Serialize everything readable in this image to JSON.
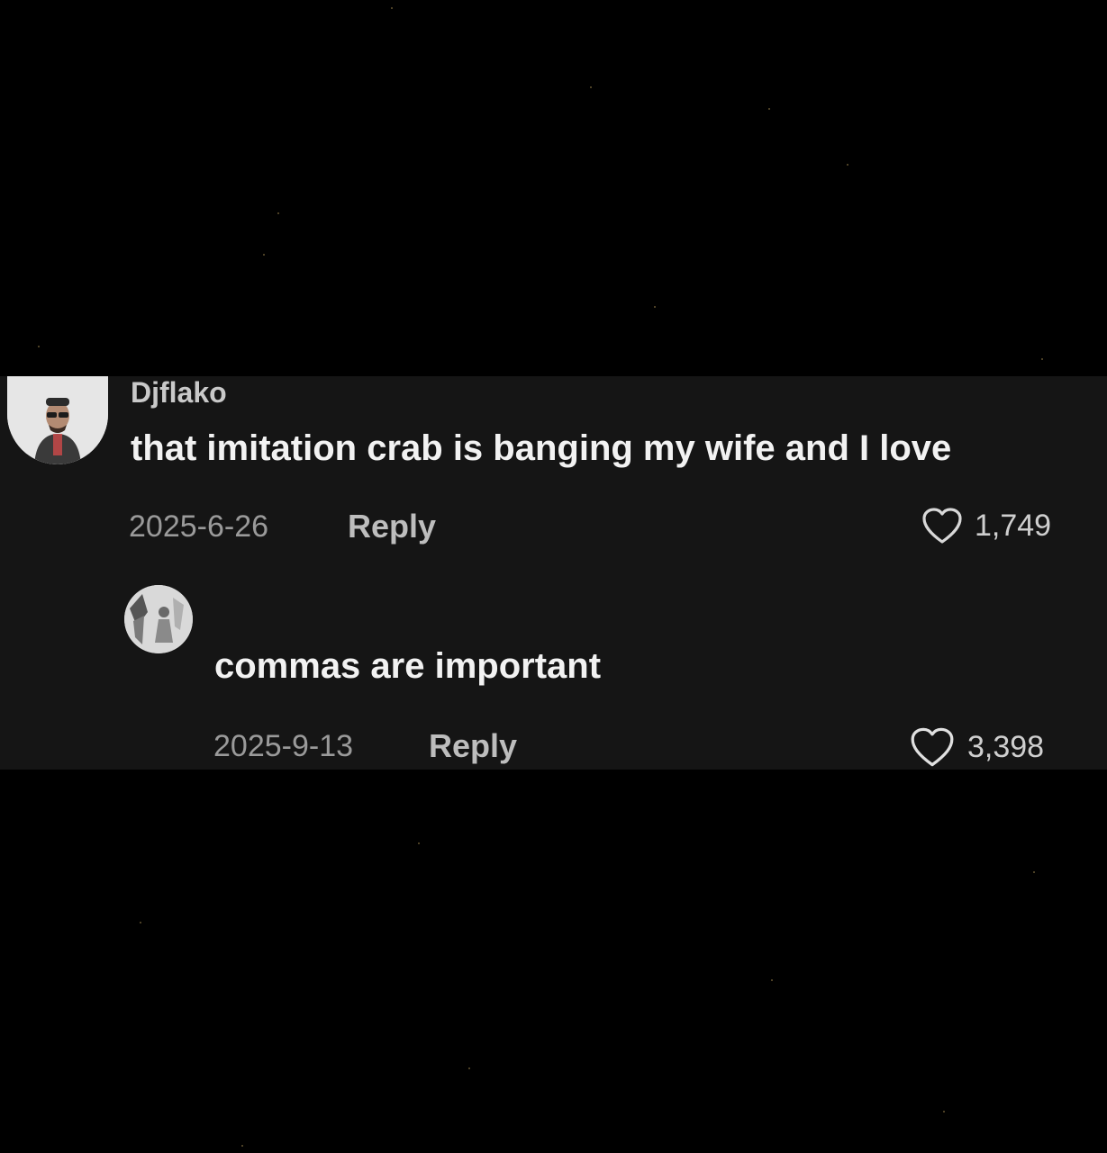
{
  "background_color": "#000000",
  "panel_color": "#151515",
  "comments": [
    {
      "username": "Djflako",
      "text": "that imitation crab is banging my wife and I love",
      "date": "2025-6-26",
      "reply_label": "Reply",
      "likes": "1,749",
      "avatar_icon": "user-avatar-icon"
    },
    {
      "username": "",
      "text": "commas are important",
      "date": "2025-9-13",
      "reply_label": "Reply",
      "likes": "3,398",
      "avatar_icon": "user-avatar-icon"
    }
  ],
  "icons": {
    "like": "heart-outline-icon"
  }
}
